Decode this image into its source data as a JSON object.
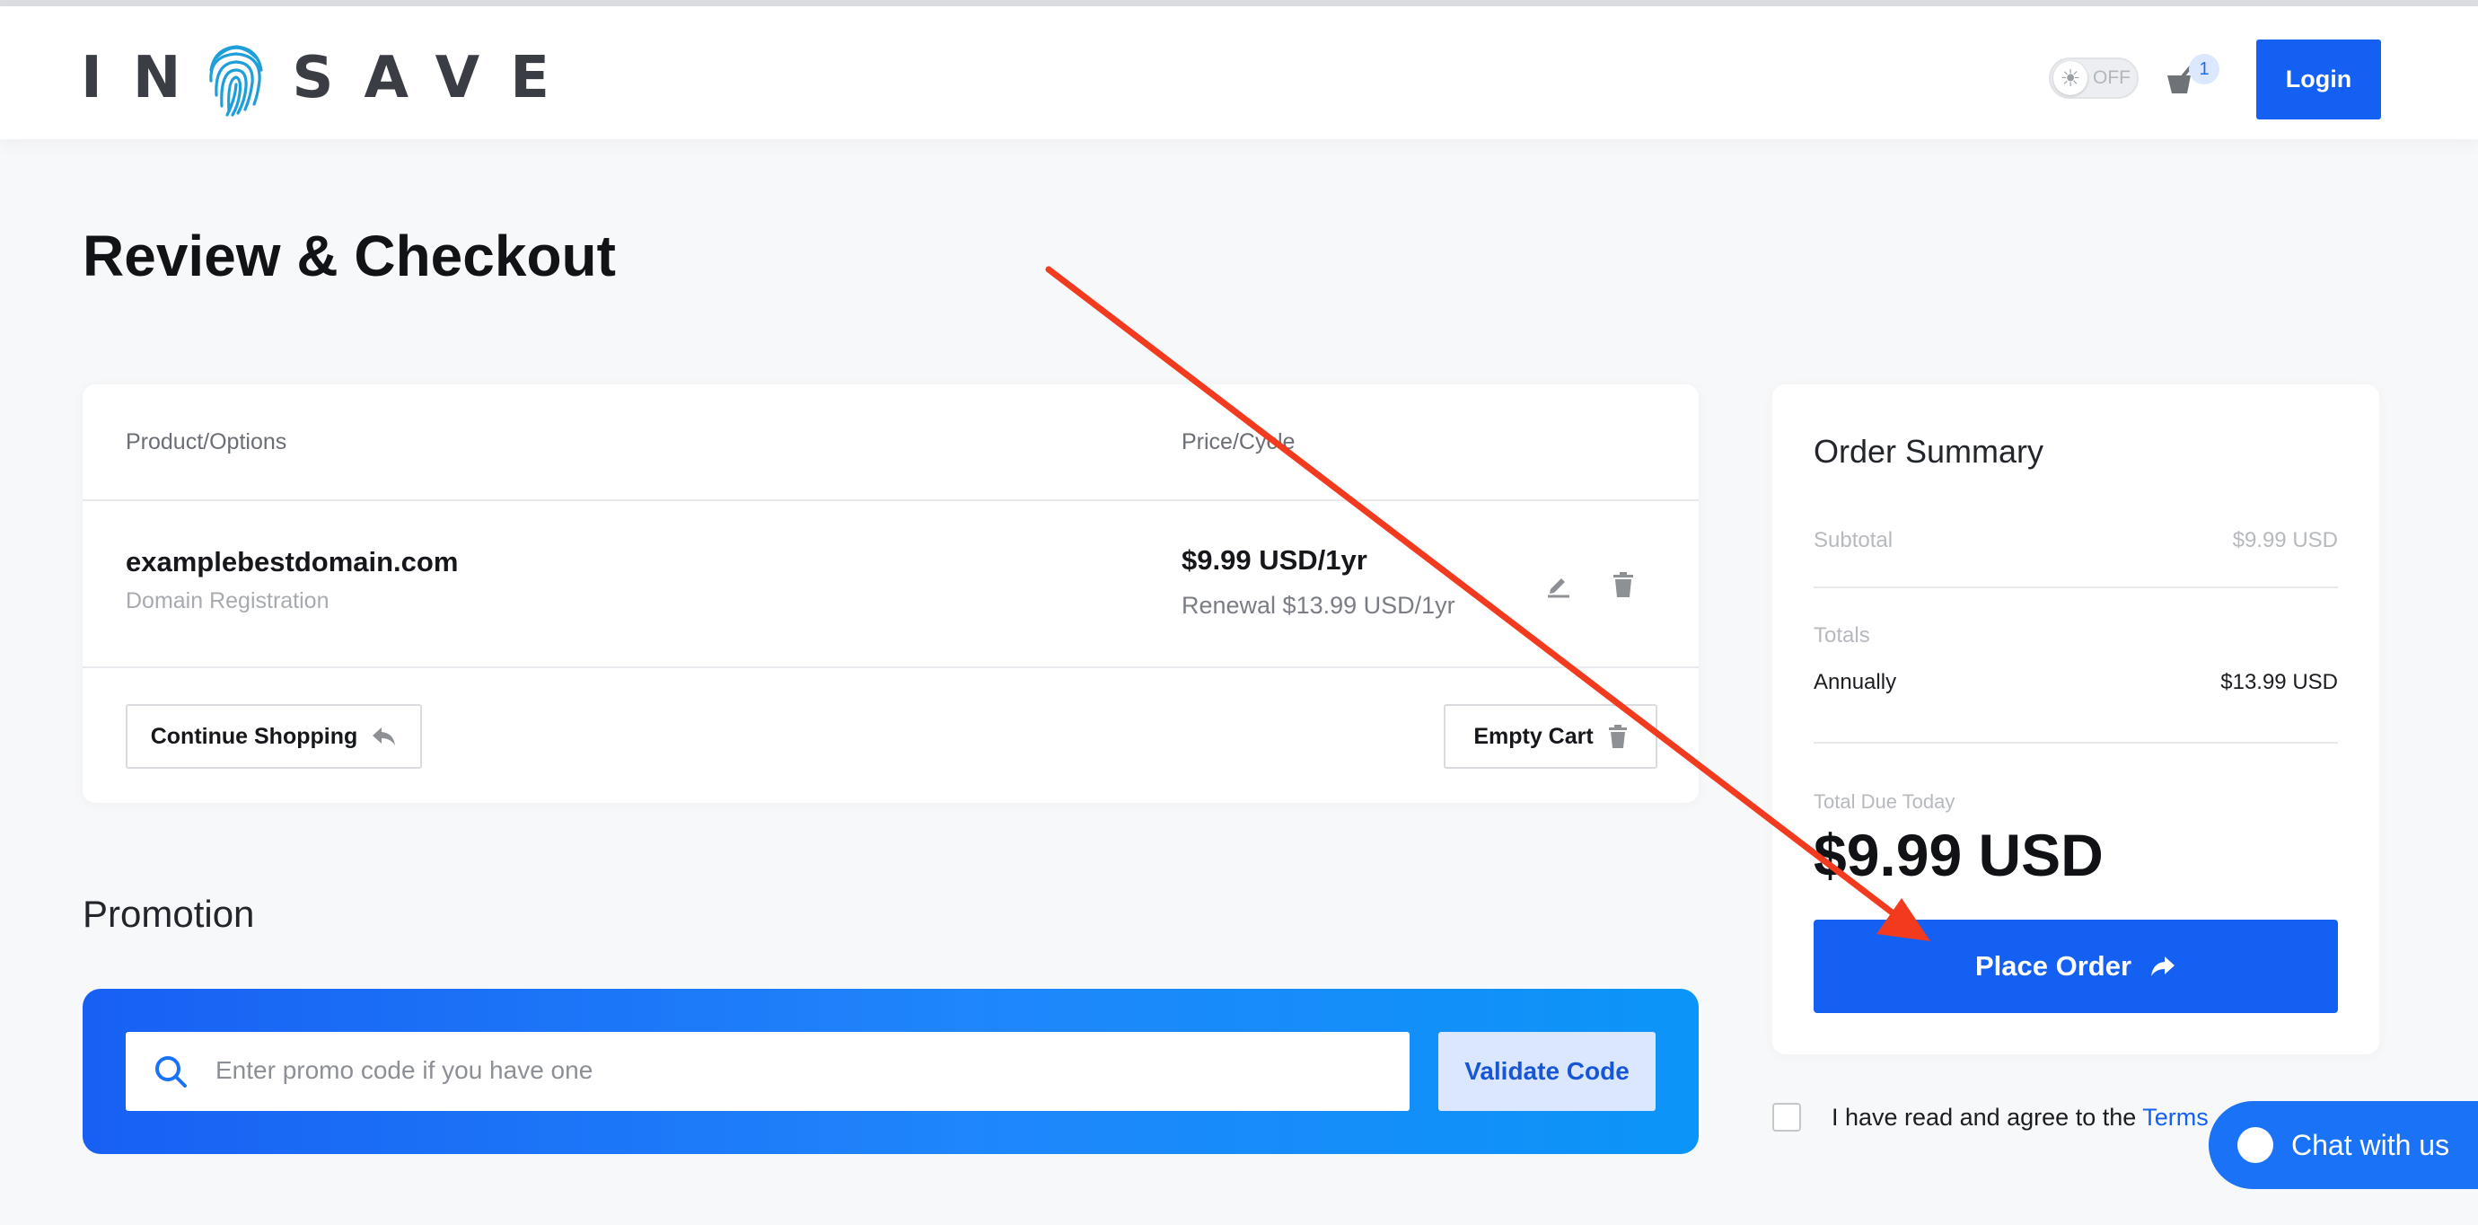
{
  "header": {
    "logo_text_left": "IN",
    "logo_text_right": "SAVE",
    "theme_toggle_label": "OFF",
    "cart_count": "1",
    "login_label": "Login"
  },
  "page": {
    "title": "Review & Checkout"
  },
  "cart": {
    "col_product": "Product/Options",
    "col_price": "Price/Cycle",
    "item": {
      "name": "examplebestdomain.com",
      "type": "Domain Registration",
      "price": "$9.99 USD/1yr",
      "renewal": "Renewal $13.99 USD/1yr"
    },
    "continue_label": "Continue Shopping",
    "empty_label": "Empty Cart"
  },
  "promotion": {
    "title": "Promotion",
    "placeholder": "Enter promo code if you have one",
    "validate_label": "Validate Code"
  },
  "summary": {
    "title": "Order Summary",
    "subtotal_label": "Subtotal",
    "subtotal_value": "$9.99 USD",
    "totals_label": "Totals",
    "annually_label": "Annually",
    "annually_value": "$13.99 USD",
    "due_label": "Total Due Today",
    "due_value": "$9.99 USD",
    "place_label": "Place Order"
  },
  "terms": {
    "text": "I have read and agree to the ",
    "link": "Terms"
  },
  "chat": {
    "label": "Chat with us"
  },
  "colors": {
    "accent": "#1460f2",
    "annotation_arrow": "#f23a1f"
  }
}
